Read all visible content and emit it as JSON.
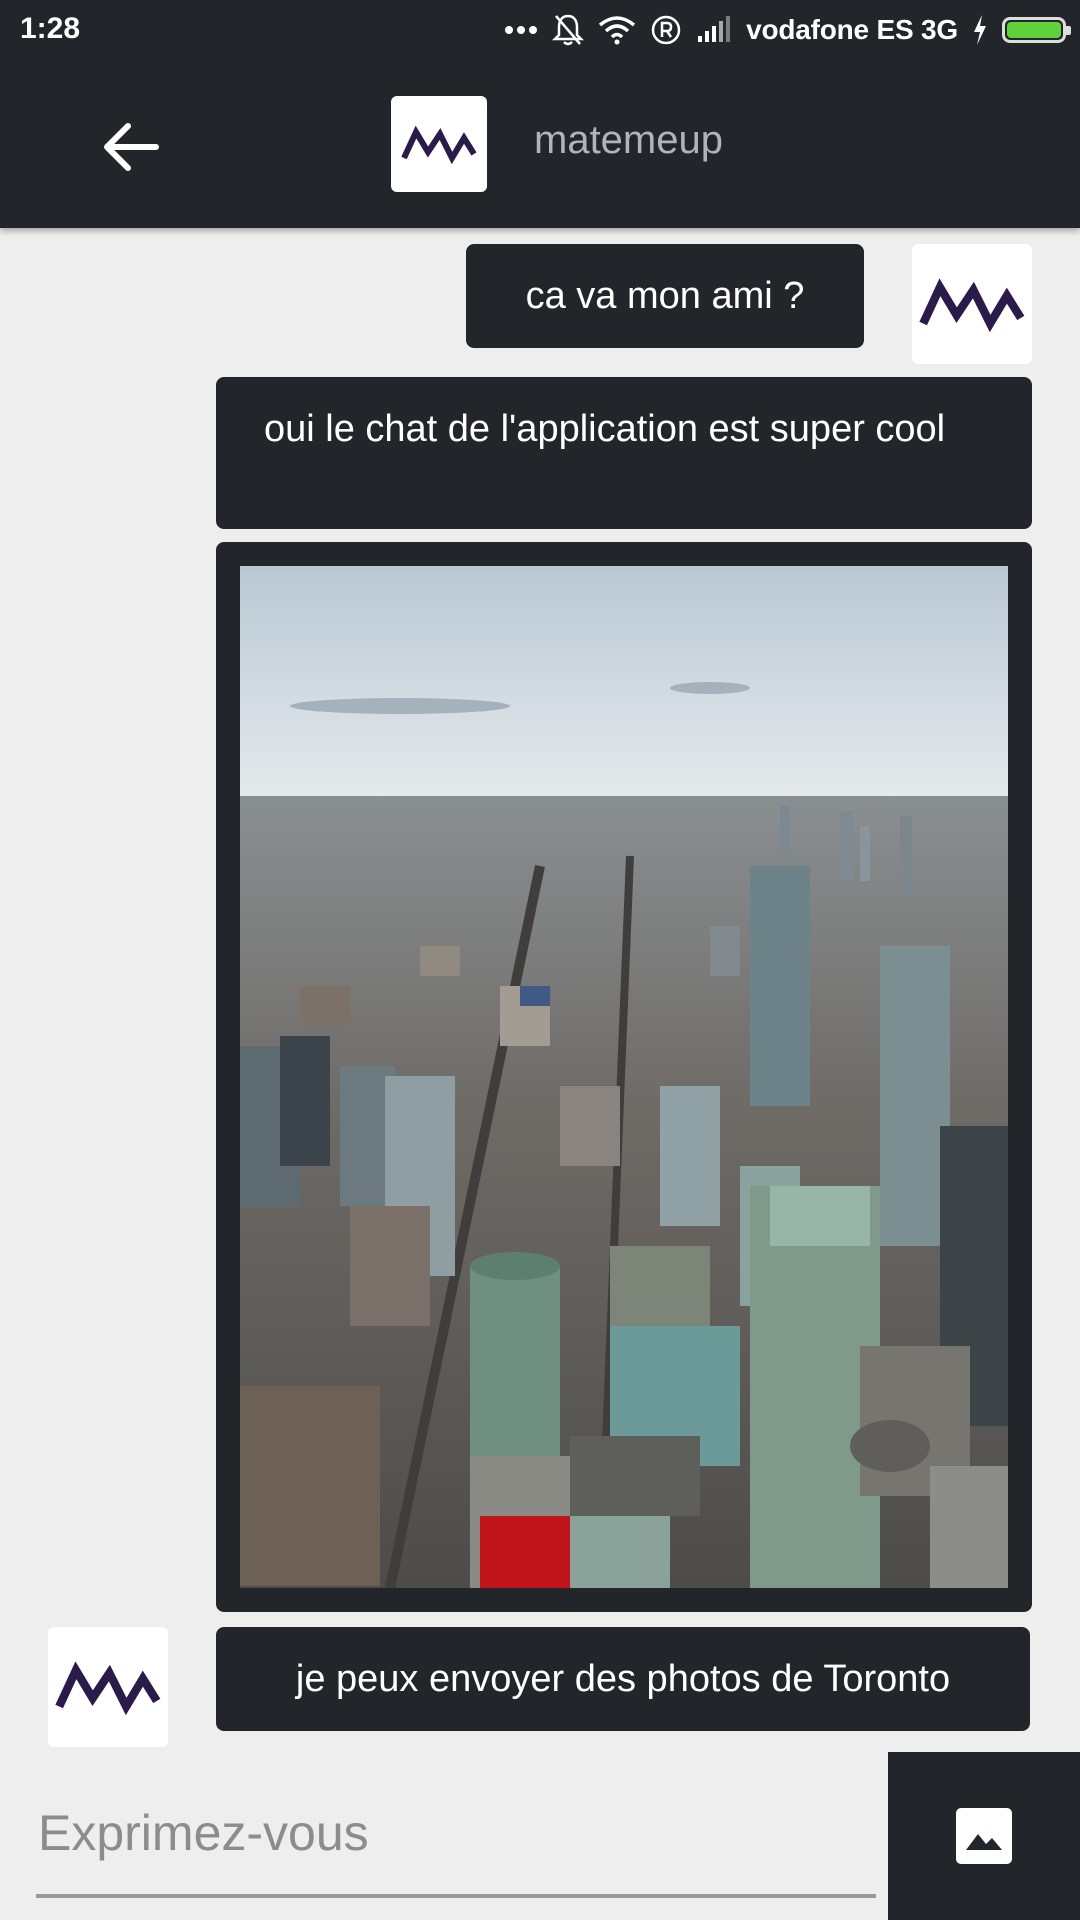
{
  "status_bar": {
    "time": "1:28",
    "carrier": "vodafone ES 3G",
    "icons": [
      "more-icon",
      "bell-off-icon",
      "wifi-icon",
      "registered-icon",
      "signal-icon",
      "charging-icon",
      "battery-icon"
    ],
    "battery_color": "#5fd23b"
  },
  "header": {
    "title": "matemeup",
    "logo_color": "#2a1b4a"
  },
  "messages": [
    {
      "side": "right",
      "type": "text",
      "text": "ca va mon ami ?"
    },
    {
      "side": "right",
      "type": "text",
      "text": "oui le chat de l'application est super cool"
    },
    {
      "side": "right",
      "type": "image",
      "alt": "Toronto aerial city photo"
    },
    {
      "side": "left",
      "type": "text",
      "text": "je peux envoyer des photos de Toronto"
    }
  ],
  "composer": {
    "placeholder": "Exprimez-vous",
    "value": ""
  },
  "colors": {
    "dark": "#22252a",
    "background": "#eeeeee",
    "accent": "#2a1b4a"
  }
}
